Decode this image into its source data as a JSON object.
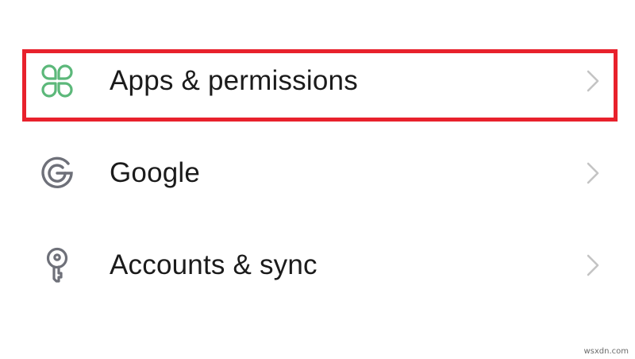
{
  "settings": {
    "items": [
      {
        "label": "Apps & permissions",
        "icon": "apps-grid-icon",
        "icon_color": "#5cb87a"
      },
      {
        "label": "Google",
        "icon": "google-g-icon",
        "icon_color": "#6e7079"
      },
      {
        "label": "Accounts & sync",
        "icon": "key-icon",
        "icon_color": "#6e7079"
      }
    ],
    "chevron_color": "#c4c4c4"
  },
  "highlight": {
    "color": "#e8212c"
  },
  "watermark": {
    "text": "wsxdn.com"
  }
}
